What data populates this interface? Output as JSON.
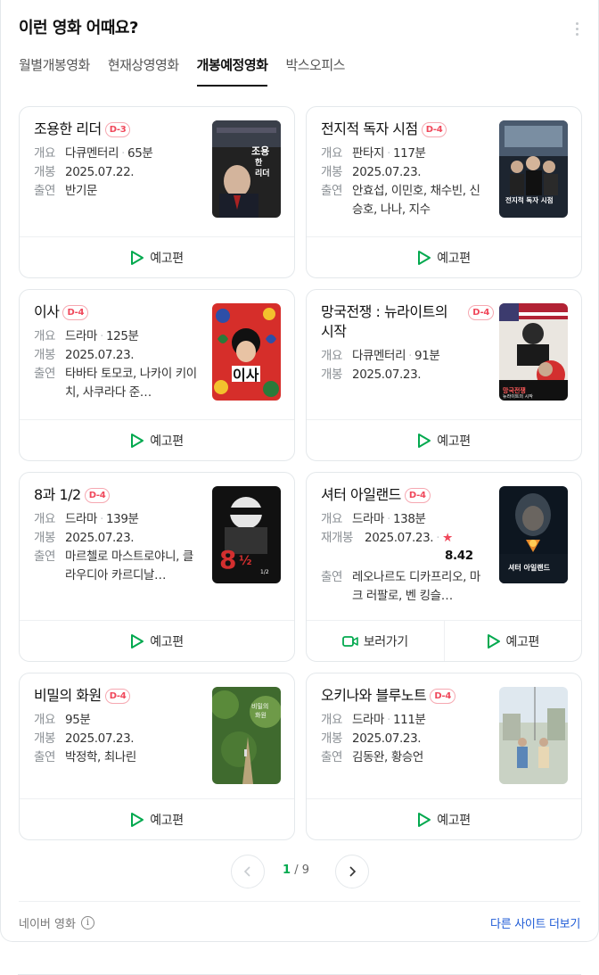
{
  "header": {
    "title": "이런 영화 어때요?"
  },
  "tabs": [
    "월별개봉영화",
    "현재상영영화",
    "개봉예정영화",
    "박스오피스"
  ],
  "labels": {
    "genre": "개요",
    "release": "개봉",
    "rerelease": "재개봉",
    "cast": "출연",
    "trailer": "예고편",
    "watch": "보러가기",
    "dot": "·"
  },
  "movies": [
    {
      "title": "조용한 리더",
      "badge": "D-3",
      "genre": "다큐멘터리",
      "runtime": "65분",
      "date": "2025.07.22.",
      "cast": "반기문",
      "poster_icon": "poster-quiet-leader"
    },
    {
      "title": "전지적 독자 시점",
      "badge": "D-4",
      "genre": "판타지",
      "runtime": "117분",
      "date": "2025.07.23.",
      "cast": "안효섭, 이민호, 채수빈, 신승호, 나나, 지수",
      "poster_icon": "poster-omniscient-reader"
    },
    {
      "title": "이사",
      "badge": "D-4",
      "genre": "드라마",
      "runtime": "125분",
      "date": "2025.07.23.",
      "cast": "타바타 토모코, 나카이 키이치, 사쿠라다 준…",
      "poster_icon": "poster-moving"
    },
    {
      "title": "망국전쟁 : 뉴라이트의 시작",
      "badge": "D-4",
      "genre": "다큐멘터리",
      "runtime": "91분",
      "date": "2025.07.23.",
      "cast": "",
      "poster_icon": "poster-mangguk"
    },
    {
      "title": "8과 1/2",
      "badge": "D-4",
      "genre": "드라마",
      "runtime": "139분",
      "date": "2025.07.23.",
      "cast": "마르첼로 마스트로야니, 클라우디아 카르디날…",
      "poster_icon": "poster-8-half"
    },
    {
      "title": "셔터 아일랜드",
      "badge": "D-4",
      "genre": "드라마",
      "runtime": "138분",
      "date": "2025.07.23.",
      "rating": "8.42",
      "cast": "레오나르도 디카프리오, 마크 러팔로, 벤 킹슬…",
      "poster_icon": "poster-shutter-island"
    },
    {
      "title": "비밀의 화원",
      "badge": "D-4",
      "genre": "",
      "runtime": "95분",
      "date": "2025.07.23.",
      "cast": "박정학, 최나린",
      "poster_icon": "poster-secret-garden"
    },
    {
      "title": "오키나와 블루노트",
      "badge": "D-4",
      "genre": "드라마",
      "runtime": "111분",
      "date": "2025.07.23.",
      "cast": "김동완, 황승언",
      "poster_icon": "poster-okinawa"
    }
  ],
  "pagination": {
    "current": "1",
    "separator": "/",
    "total": "9"
  },
  "footer": {
    "source": "네이버 영화",
    "more_sites": "다른 사이트 더보기",
    "info_glyph": "i"
  },
  "colors": {
    "accent_green": "#03a94f",
    "dday_red": "#f0485b",
    "link_blue": "#1e5bd6"
  }
}
